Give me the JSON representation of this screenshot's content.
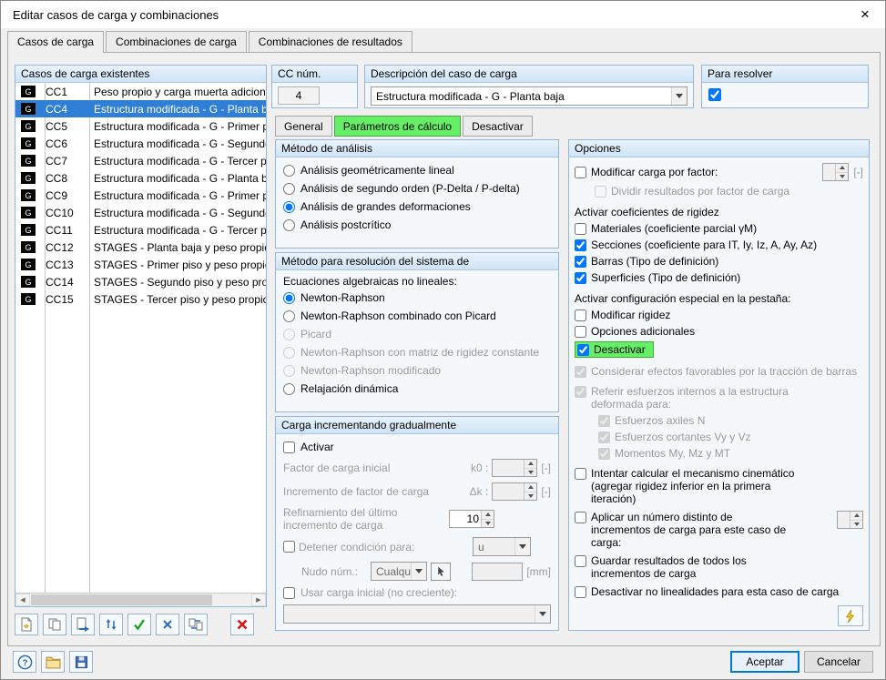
{
  "window": {
    "title": "Editar casos de carga y combinaciones",
    "close_glyph": "×"
  },
  "tabs": {
    "active_index": 0,
    "items": [
      {
        "label": "Casos de carga"
      },
      {
        "label": "Combinaciones de carga"
      },
      {
        "label": "Combinaciones de resultados"
      }
    ]
  },
  "load_cases": {
    "header": "Casos de carga existentes",
    "rows": [
      {
        "tag": "G",
        "id": "CC1",
        "desc": "Peso propio y carga muerta adicional",
        "selected": false
      },
      {
        "tag": "G",
        "id": "CC4",
        "desc": "Estructura modificada - G - Planta baja",
        "selected": true
      },
      {
        "tag": "G",
        "id": "CC5",
        "desc": "Estructura modificada - G - Primer piso",
        "selected": false
      },
      {
        "tag": "G",
        "id": "CC6",
        "desc": "Estructura modificada - G - Segundo pis",
        "selected": false
      },
      {
        "tag": "G",
        "id": "CC7",
        "desc": "Estructura modificada - G - Tercer piso",
        "selected": false
      },
      {
        "tag": "G",
        "id": "CC8",
        "desc": "Estructura modificada - G - Planta baja",
        "selected": false
      },
      {
        "tag": "G",
        "id": "CC9",
        "desc": "Estructura modificada - G - Primer piso",
        "selected": false
      },
      {
        "tag": "G",
        "id": "CC10",
        "desc": "Estructura modificada - G - Segundo pis",
        "selected": false
      },
      {
        "tag": "G",
        "id": "CC11",
        "desc": "Estructura modificada - G - Tercer piso",
        "selected": false
      },
      {
        "tag": "G",
        "id": "CC12",
        "desc": "STAGES - Planta baja y peso propio",
        "selected": false
      },
      {
        "tag": "G",
        "id": "CC13",
        "desc": "STAGES - Primer piso y peso propio",
        "selected": false
      },
      {
        "tag": "G",
        "id": "CC14",
        "desc": "STAGES - Segundo piso y peso propio",
        "selected": false
      },
      {
        "tag": "G",
        "id": "CC15",
        "desc": "STAGES - Tercer piso y peso propio",
        "selected": false
      }
    ],
    "left_toolbar": [
      "new-load-case",
      "copy-load-case",
      "edit-load-case",
      "renumber-load-cases",
      "apply-check",
      "delete-values",
      "transfer-load-cases",
      "delete-load-case"
    ]
  },
  "cc_num": {
    "header": "CC núm.",
    "value": "4"
  },
  "descripcion": {
    "header": "Descripción del caso de carga",
    "value": "Estructura modificada - G - Planta baja"
  },
  "para_resolver": {
    "header": "Para resolver",
    "checked": true
  },
  "inner_tabs": {
    "active_index": 1,
    "items": [
      {
        "label": "General"
      },
      {
        "label": "Parámetros de cálculo"
      },
      {
        "label": "Desactivar"
      }
    ]
  },
  "metodo_analisis": {
    "header": "Método de análisis",
    "options": [
      {
        "label": "Análisis geométricamente lineal",
        "checked": false,
        "disabled": false
      },
      {
        "label": "Análisis de segundo orden (P-Delta / P-delta)",
        "checked": false,
        "disabled": false
      },
      {
        "label": "Análisis de grandes deformaciones",
        "checked": true,
        "disabled": false
      },
      {
        "label": "Análisis postcrítico",
        "checked": false,
        "disabled": false
      }
    ]
  },
  "metodo_resolucion": {
    "header": "Método para resolución del sistema de",
    "sublabel": "Ecuaciones algebraicas no lineales:",
    "options": [
      {
        "label": "Newton-Raphson",
        "checked": true,
        "disabled": false
      },
      {
        "label": "Newton-Raphson combinado con Picard",
        "checked": false,
        "disabled": false
      },
      {
        "label": "Picard",
        "checked": false,
        "disabled": true
      },
      {
        "label": "Newton-Raphson con matriz de rigidez constante",
        "checked": false,
        "disabled": true
      },
      {
        "label": "Newton-Raphson modificado",
        "checked": false,
        "disabled": true
      },
      {
        "label": "Relajación dinámica",
        "checked": false,
        "disabled": false
      }
    ]
  },
  "carga_incremental": {
    "header": "Carga incrementando gradualmente",
    "activar_label": "Activar",
    "activar_checked": false,
    "factor_inicial_label": "Factor de carga inicial",
    "factor_inicial_sym": "k0 :",
    "factor_inicial_value": "",
    "factor_inicial_unit": "[-]",
    "incremento_label": "Incremento de factor de carga",
    "incremento_sym": "Δk :",
    "incremento_value": "",
    "incremento_unit": "[-]",
    "refinamiento_label": "Refinamiento del último incremento de carga",
    "refinamiento_value": "10",
    "detener_label": "Detener condición para:",
    "detener_checked": false,
    "detener_value": "u",
    "nudo_label": "Nudo núm.:",
    "nudo_combo": "Cualqui",
    "nudo_value": "",
    "nudo_unit": "[mm]",
    "usar_label": "Usar carga inicial (no creciente):",
    "usar_checked": false,
    "usar_value": ""
  },
  "opciones": {
    "header": "Opciones",
    "modificar_carga": {
      "label": "Modificar carga por factor:",
      "checked": false,
      "value": "",
      "unit": "[-]"
    },
    "dividir": {
      "label": "Dividir resultados por factor de carga",
      "checked": false,
      "disabled": true
    },
    "coef_rigidez_label": "Activar coeficientes de rigidez",
    "materiales": {
      "label": "Materiales (coeficiente parcial γM)",
      "checked": false
    },
    "secciones": {
      "label": "Secciones (coeficiente para IT, Iy, Iz, A, Ay, Az)",
      "checked": true
    },
    "barras": {
      "label": "Barras (Tipo de definición)",
      "checked": true
    },
    "superficies": {
      "label": "Superficies (Tipo de definición)",
      "checked": true
    },
    "config_especial_label": "Activar configuración especial en la pestaña:",
    "modificar_rigidez": {
      "label": "Modificar rigidez",
      "checked": false
    },
    "opciones_adicionales": {
      "label": "Opciones adicionales",
      "checked": false
    },
    "desactivar": {
      "label": "Desactivar",
      "checked": true
    },
    "considerar": {
      "label": "Considerar efectos favorables por la tracción de barras",
      "checked": true,
      "disabled": true
    },
    "referir": {
      "label": "Referir esfuerzos internos a la estructura deformada para:",
      "checked": true,
      "disabled": true
    },
    "axiles": {
      "label": "Esfuerzos axiles N",
      "checked": true,
      "disabled": true
    },
    "cortantes": {
      "label": "Esfuerzos cortantes Vy y Vz",
      "checked": true,
      "disabled": true
    },
    "momentos": {
      "label": "Momentos My, Mz y MT",
      "checked": true,
      "disabled": true
    },
    "mecanismo": {
      "label": "Intentar calcular el mecanismo cinemático (agregar rigidez inferior en la primera iteración)",
      "checked": false
    },
    "aplicar_incrementos": {
      "label": "Aplicar un número distinto de incrementos de carga para este caso de carga:",
      "checked": false,
      "value": ""
    },
    "guardar": {
      "label": "Guardar resultados de todos los incrementos de carga",
      "checked": false
    },
    "desactivar_nolin": {
      "label": "Desactivar no linealidades para esta caso de carga",
      "checked": false
    }
  },
  "icons": {
    "scroll_left": "◀",
    "scroll_right": "▶",
    "help": "?"
  },
  "footer": {
    "aceptar": "Aceptar",
    "cancelar": "Cancelar"
  }
}
